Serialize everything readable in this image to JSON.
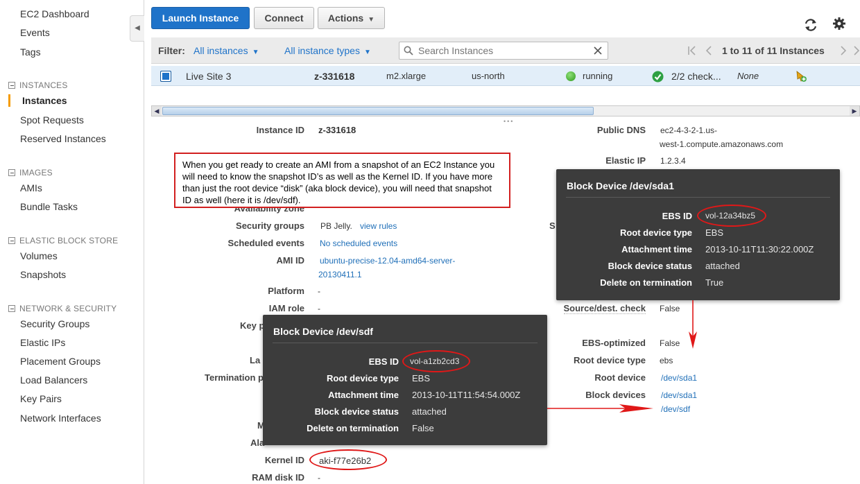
{
  "sidebar": {
    "items": [
      {
        "label": "EC2 Dashboard"
      },
      {
        "label": "Events"
      },
      {
        "label": "Tags"
      }
    ],
    "sections": [
      {
        "title": "INSTANCES",
        "items": [
          "Instances",
          "Spot Requests",
          "Reserved Instances"
        ]
      },
      {
        "title": "IMAGES",
        "items": [
          "AMIs",
          "Bundle Tasks"
        ]
      },
      {
        "title": "ELASTIC BLOCK STORE",
        "items": [
          "Volumes",
          "Snapshots"
        ]
      },
      {
        "title": "NETWORK & SECURITY",
        "items": [
          "Security Groups",
          "Elastic IPs",
          "Placement Groups",
          "Load Balancers",
          "Key Pairs",
          "Network Interfaces"
        ]
      }
    ]
  },
  "toolbar": {
    "launch_label": "Launch Instance",
    "connect_label": "Connect",
    "actions_label": "Actions"
  },
  "filter": {
    "label": "Filter:",
    "instances_dd": "All instances",
    "types_dd": "All instance types",
    "search_placeholder": "Search Instances",
    "pager": "1 to 11 of 11 Instances"
  },
  "instance_row": {
    "name": "Live Site 3",
    "id": "z-331618",
    "type": "m2.xlarge",
    "zone": "us-north",
    "state": "running",
    "checks": "2/2 check...",
    "alarm": "None"
  },
  "details": {
    "instance_id_label": "Instance ID",
    "instance_id": "z-331618",
    "public_dns_label": "Public DNS",
    "public_dns_line1": "ec2-4-3-2-1.us-",
    "public_dns_line2": "west-1.compute.amazonaws.com",
    "elastic_ip_label": "Elastic IP",
    "elastic_ip": "1.2.3.4",
    "availability_zone_label": "Availability zone",
    "security_groups_label": "Security groups",
    "security_groups_value": "PB Jelly.",
    "view_rules": "view rules",
    "scheduled_events_label": "Scheduled events",
    "scheduled_events_value": "No scheduled events",
    "ami_id_label": "AMI ID",
    "ami_id_line1": "ubuntu-precise-12.04-amd64-server-",
    "ami_id_line2": "20130411.1",
    "platform_label": "Platform",
    "platform_value": "-",
    "iam_role_label": "IAM role",
    "iam_role_value": "-",
    "key_pair_label": "Key p",
    "launch_label": "La",
    "termination_label": "Termination p",
    "monitoring_label": "M",
    "alarm_label": "Ala",
    "kernel_id_label": "Kernel ID",
    "kernel_id": "aki-f77e26b2",
    "ramdisk_label": "RAM disk ID",
    "ramdisk_value": "-",
    "s_label": "S",
    "source_dest_label": "Source/dest. check",
    "source_dest_value": "False",
    "ebs_opt_label": "EBS-optimized",
    "ebs_opt_value": "False",
    "root_type_label": "Root device type",
    "root_type_value": "ebs",
    "root_device_label": "Root device",
    "root_device_value": "/dev/sda1",
    "block_devices_label": "Block devices",
    "block_device_1": "/dev/sda1",
    "block_device_2": "/dev/sdf"
  },
  "callout": {
    "text": "When you get ready to create an AMI from a snapshot of an EC2 Instance you will need to know the snapshot ID’s as well as the Kernel ID.  If you have more than just the root device “disk” (aka block device), you will need that snapshot ID as well (here it is /dev/sdf)."
  },
  "popup_sda1": {
    "title": "Block Device /dev/sda1",
    "ebs_id_label": "EBS ID",
    "ebs_id": "vol-12a34bz5",
    "root_type_label": "Root device type",
    "root_type": "EBS",
    "attach_label": "Attachment time",
    "attach": "2013-10-11T11:30:22.000Z",
    "status_label": "Block device status",
    "status": "attached",
    "delete_label": "Delete on termination",
    "delete": "True"
  },
  "popup_sdf": {
    "title": "Block Device /dev/sdf",
    "ebs_id_label": "EBS ID",
    "ebs_id": "vol-a1zb2cd3",
    "root_type_label": "Root device type",
    "root_type": "EBS",
    "attach_label": "Attachment time",
    "attach": "2013-10-11T11:54:54.000Z",
    "status_label": "Block device status",
    "status": "attached",
    "delete_label": "Delete on termination",
    "delete": "False"
  },
  "colors": {
    "primary": "#1f73c9",
    "annotation_red": "#e01818",
    "popup_bg": "#3c3c3c",
    "running_green": "#3fae29"
  }
}
